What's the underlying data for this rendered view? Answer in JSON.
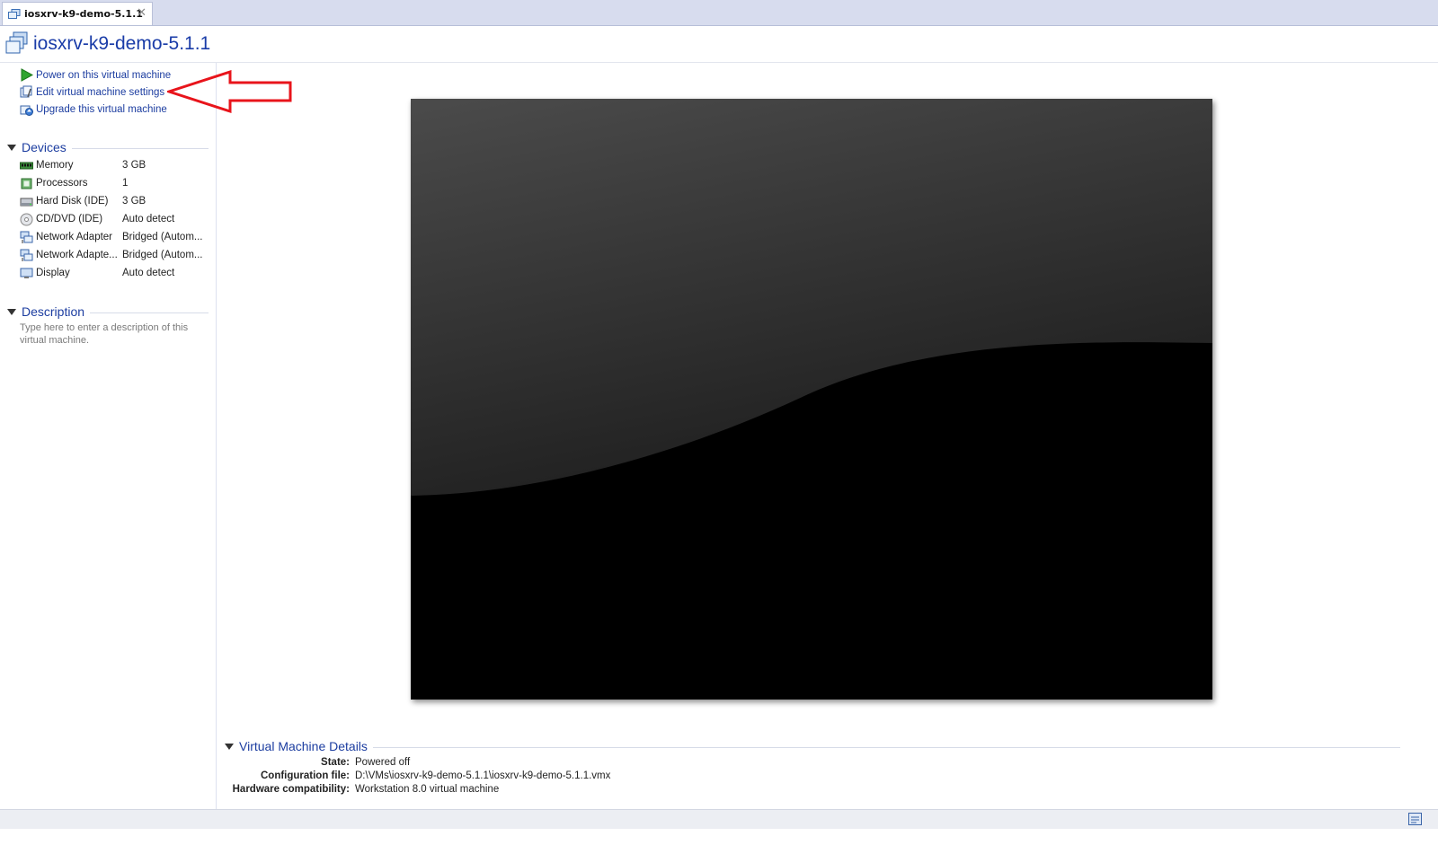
{
  "tab": {
    "title": "iosxrv-k9-demo-5.1.1",
    "close": "✕"
  },
  "header": {
    "title": "iosxrv-k9-demo-5.1.1"
  },
  "commands": [
    {
      "label": "Power on this virtual machine",
      "icon": "play-icon"
    },
    {
      "label": "Edit virtual machine settings",
      "icon": "settings-icon"
    },
    {
      "label": "Upgrade this virtual machine",
      "icon": "upgrade-icon"
    }
  ],
  "devices": {
    "title": "Devices",
    "items": [
      {
        "name": "Memory",
        "value": "3 GB",
        "icon": "memory-icon"
      },
      {
        "name": "Processors",
        "value": "1",
        "icon": "processor-icon"
      },
      {
        "name": "Hard Disk (IDE)",
        "value": "3 GB",
        "icon": "harddisk-icon"
      },
      {
        "name": "CD/DVD (IDE)",
        "value": "Auto detect",
        "icon": "cdrom-icon"
      },
      {
        "name": "Network Adapter",
        "value": "Bridged (Autom...",
        "icon": "network-icon"
      },
      {
        "name": "Network Adapte...",
        "value": "Bridged (Autom...",
        "icon": "network-icon"
      },
      {
        "name": "Display",
        "value": "Auto detect",
        "icon": "display-icon"
      }
    ]
  },
  "description": {
    "title": "Description",
    "placeholder": "Type here to enter a description of this virtual machine."
  },
  "details": {
    "title": "Virtual Machine Details",
    "rows": [
      {
        "key": "State:",
        "value": "Powered off"
      },
      {
        "key": "Configuration file:",
        "value": "D:\\VMs\\iosxrv-k9-demo-5.1.1\\iosxrv-k9-demo-5.1.1.vmx"
      },
      {
        "key": "Hardware compatibility:",
        "value": "Workstation 8.0 virtual machine"
      }
    ]
  },
  "colors": {
    "link": "#1c3da0",
    "tabbar": "#d7dcee",
    "annotation": "#e8141b"
  }
}
